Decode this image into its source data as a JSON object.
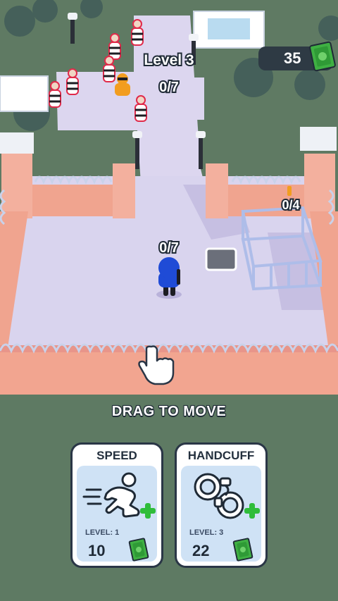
{
  "hud": {
    "level_label": "Level 3",
    "money": "35",
    "money_icon": "cash-bill-icon"
  },
  "scene": {
    "yard_counter": "0/7",
    "player_counter": "0/7",
    "cell_counter": "0/4",
    "colors": {
      "fence": "#f0a48f",
      "yard_floor": "#d9d4ee",
      "grass": "#5f7a63",
      "police_blue": "#1f4bd6"
    }
  },
  "hint": {
    "text": "DRAG TO MOVE",
    "icon": "pointing-hand-icon"
  },
  "upgrades": [
    {
      "title": "SPEED",
      "level": "LEVEL: 1",
      "cost": "10",
      "icon": "running-person-icon"
    },
    {
      "title": "HANDCUFF",
      "level": "LEVEL: 3",
      "cost": "22",
      "icon": "handcuffs-icon"
    }
  ]
}
